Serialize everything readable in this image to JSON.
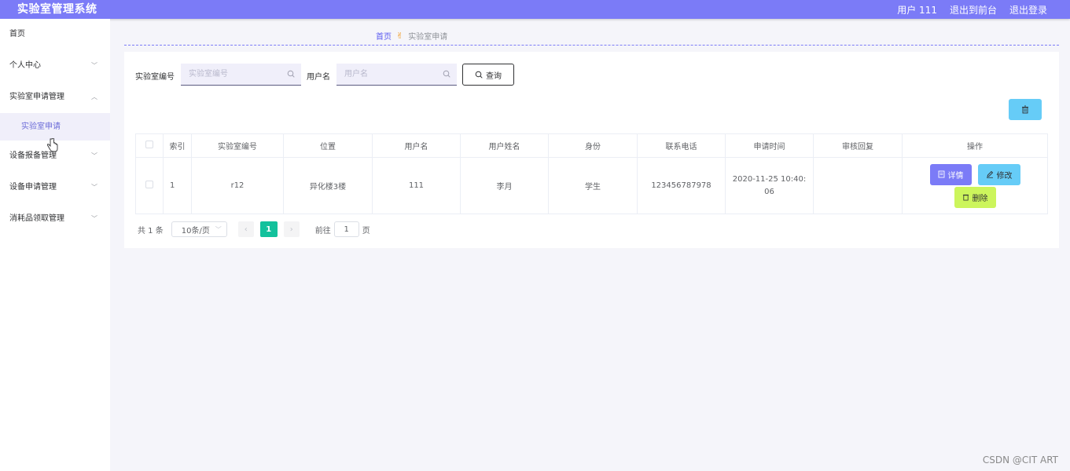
{
  "app": {
    "title": "实验室管理系统"
  },
  "header": {
    "user_label": "用户 111",
    "front_label": "退出到前台",
    "logout_label": "退出登录"
  },
  "sidebar": {
    "items": [
      {
        "label": "首页"
      },
      {
        "label": "个人中心"
      },
      {
        "label": "实验室申请管理"
      },
      {
        "label": "实验室申请"
      },
      {
        "label": "设备报备管理"
      },
      {
        "label": "设备申请管理"
      },
      {
        "label": "消耗品领取管理"
      }
    ]
  },
  "breadcrumb": {
    "home": "首页",
    "current": "实验室申请"
  },
  "filters": {
    "lab_no_label": "实验室编号",
    "lab_no_placeholder": "实验室编号",
    "username_label": "用户名",
    "username_placeholder": "用户名",
    "query_label": "查询"
  },
  "table": {
    "headers": [
      "索引",
      "实验室编号",
      "位置",
      "用户名",
      "用户姓名",
      "身份",
      "联系电话",
      "申请时间",
      "审核回复",
      "操作"
    ],
    "rows": [
      {
        "index": "1",
        "lab_no": "r12",
        "location": "异化楼3楼",
        "username": "111",
        "name": "李月",
        "identity": "学生",
        "phone": "123456787978",
        "apply_time": "2020-11-25 10:40:06",
        "reply": "",
        "actions": {
          "detail": "详情",
          "edit": "修改",
          "delete": "删除"
        }
      }
    ]
  },
  "pagination": {
    "total_label": "共 1 条",
    "page_size": "10条/页",
    "current_page": "1",
    "goto_label": "前往",
    "goto_value": "1",
    "page_suffix": "页"
  },
  "watermark": "CSDN @CIT ART",
  "colors": {
    "header_bg": "#7b7bf7",
    "detail_btn": "#7b7bf7",
    "edit_btn": "#66ccf7",
    "delete_btn": "#ccf55c",
    "active_page": "#13c19c"
  }
}
